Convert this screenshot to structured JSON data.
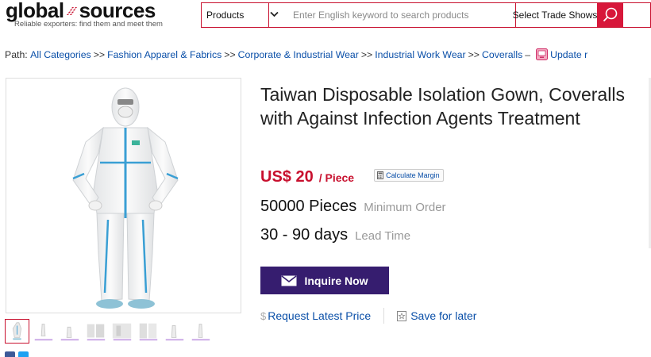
{
  "header": {
    "logo_left": "global",
    "logo_right": "sources",
    "tagline": "Reliable exporters: find them and meet them",
    "search": {
      "category": "Products",
      "placeholder": "Enter English keyword to search products",
      "trade_shows": "Select Trade Shows",
      "button_icon": "search-icon"
    }
  },
  "breadcrumb": {
    "prefix": "Path:",
    "items": [
      "All Categories",
      "Fashion Apparel & Fabrics",
      "Corporate & Industrial Wear",
      "Industrial Work Wear",
      "Coveralls"
    ],
    "separator": ">>",
    "dash": "–",
    "update_label": "Update r"
  },
  "product": {
    "title": "Taiwan Disposable Isolation Gown, Coveralls with Against Infection Agents Treatment",
    "price": "US$ 20",
    "unit": "/ Piece",
    "calc_label": "Calculate Margin",
    "min_order_value": "50000 Pieces",
    "min_order_label": "Minimum Order",
    "lead_time_value": "30 - 90 days",
    "lead_time_label": "Lead Time",
    "inquire_label": "Inquire Now",
    "request_label": "Request Latest Price",
    "currency_symbol": "$",
    "save_label": "Save for later"
  },
  "colors": {
    "brand_red": "#c8102e",
    "inquire_purple": "#361d6f",
    "link_blue": "#0a4fa8"
  }
}
